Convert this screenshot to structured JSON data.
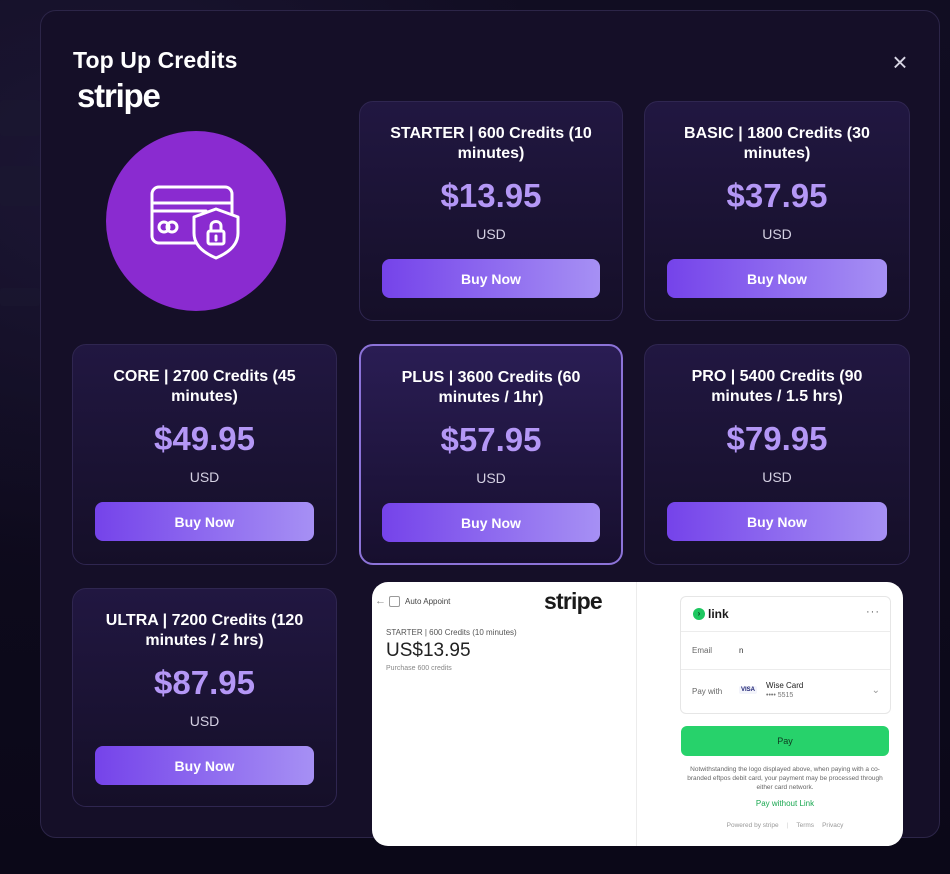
{
  "modal": {
    "title": "Top Up Credits",
    "provider_logo_text": "stripe",
    "close_label": "×"
  },
  "colors": {
    "background": "#0d0a1c",
    "modal_bg": "#150f28",
    "accent_price": "#b497f6",
    "button_gradient_start": "#7543ea",
    "button_gradient_end": "#a690f4",
    "secure_circle": "#8a2bd0",
    "link_green": "#27d26b"
  },
  "secure_icon": "credit-card-shield-lock-icon",
  "plans": [
    {
      "title": "STARTER | 600 Credits (10 minutes)",
      "price": "$13.95",
      "currency": "USD",
      "button": "Buy Now"
    },
    {
      "title": "BASIC | 1800 Credits (30 minutes)",
      "price": "$37.95",
      "currency": "USD",
      "button": "Buy Now"
    },
    {
      "title": "CORE | 2700 Credits (45 minutes)",
      "price": "$49.95",
      "currency": "USD",
      "button": "Buy Now"
    },
    {
      "title": "PLUS | 3600 Credits (60 minutes / 1hr)",
      "price": "$57.95",
      "currency": "USD",
      "button": "Buy Now",
      "highlighted": true
    },
    {
      "title": "PRO | 5400 Credits (90 minutes / 1.5 hrs)",
      "price": "$79.95",
      "currency": "USD",
      "button": "Buy Now"
    },
    {
      "title": "ULTRA | 7200 Credits (120 minutes / 2 hrs)",
      "price": "$87.95",
      "currency": "USD",
      "button": "Buy Now"
    }
  ],
  "checkout": {
    "back_icon": "back-arrow-icon",
    "store_name": "Auto Appoint",
    "logo_text": "stripe",
    "product": "STARTER | 600 Credits (10 minutes)",
    "price": "US$13.95",
    "description": "Purchase 600 credits",
    "link_label": "link",
    "link_menu": "···",
    "email_label": "Email",
    "email_value": "n",
    "pay_with_label": "Pay with",
    "card_brand": "VISA",
    "card_name": "Wise Card",
    "card_last4": "•••• 5515",
    "pay_button": "Pay",
    "notice": "Notwithstanding the logo displayed above, when paying with a co-branded eftpos debit card, your payment may be processed through either card network.",
    "pay_without_link": "Pay without Link",
    "footer_powered": "Powered by stripe",
    "footer_terms": "Terms",
    "footer_privacy": "Privacy"
  }
}
